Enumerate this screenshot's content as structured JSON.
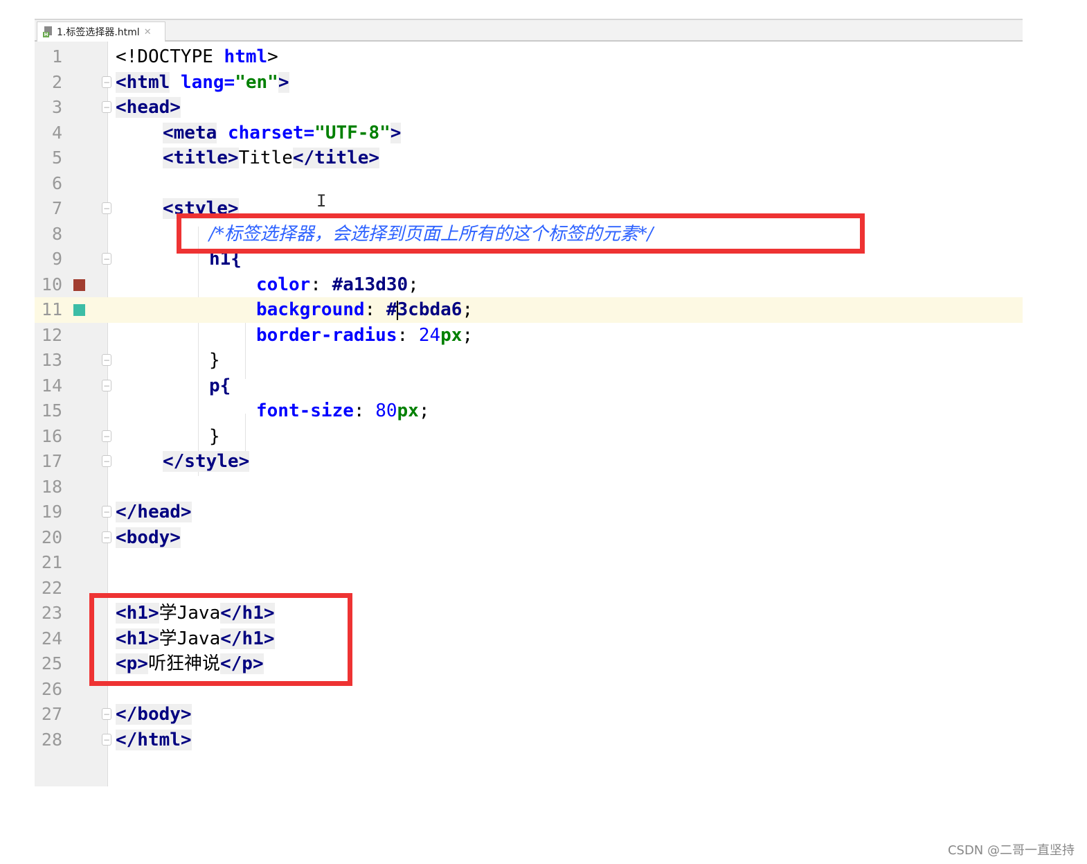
{
  "tab": {
    "filename": "1.标签选择器.html",
    "close_icon": "close-icon",
    "file_icon": "html-file-icon"
  },
  "editor": {
    "lines": [
      {
        "n": "1"
      },
      {
        "n": "2"
      },
      {
        "n": "3"
      },
      {
        "n": "4"
      },
      {
        "n": "5"
      },
      {
        "n": "6"
      },
      {
        "n": "7"
      },
      {
        "n": "8"
      },
      {
        "n": "9"
      },
      {
        "n": "10"
      },
      {
        "n": "11"
      },
      {
        "n": "12"
      },
      {
        "n": "13"
      },
      {
        "n": "14"
      },
      {
        "n": "15"
      },
      {
        "n": "16"
      },
      {
        "n": "17"
      },
      {
        "n": "18"
      },
      {
        "n": "19"
      },
      {
        "n": "20"
      },
      {
        "n": "21"
      },
      {
        "n": "22"
      },
      {
        "n": "23"
      },
      {
        "n": "24"
      },
      {
        "n": "25"
      },
      {
        "n": "26"
      },
      {
        "n": "27"
      },
      {
        "n": "28"
      }
    ],
    "code": {
      "l1_doctype": "<!DOCTYPE",
      "l1_html": "html",
      "l1_end": ">",
      "l2_tag": "<html",
      "l2_attr": "lang=",
      "l2_val": "\"en\"",
      "l2_end": ">",
      "l3": "<head>",
      "l4_tag": "<meta",
      "l4_attr": "charset=",
      "l4_val": "\"UTF-8\"",
      "l4_end": ">",
      "l5_open": "<title>",
      "l5_text": "Title",
      "l5_close": "</title>",
      "l7": "<style>",
      "l8_comment": "/*标签选择器，会选择到页面上所有的这个标签的元素*/",
      "l9": "h1{",
      "l10_prop": "color",
      "l10_colon": ": ",
      "l10_val": "#a13d30",
      "l10_semi": ";",
      "l11_prop": "background",
      "l11_colon": ": ",
      "l11_hash": "#",
      "l11_val": "3cbda6",
      "l11_semi": ";",
      "l12_prop": "border-radius",
      "l12_colon": ": ",
      "l12_num": "24",
      "l12_unit": "px",
      "l12_semi": ";",
      "l13": "}",
      "l14": "p{",
      "l15_prop": "font-size",
      "l15_colon": ": ",
      "l15_num": "80",
      "l15_unit": "px",
      "l15_semi": ";",
      "l16": "}",
      "l17": "</style>",
      "l19": "</head>",
      "l20": "<body>",
      "l23_open": "<h1>",
      "l23_text": "学Java",
      "l23_close": "</h1>",
      "l24_open": "<h1>",
      "l24_text": "学Java",
      "l24_close": "</h1>",
      "l25_open": "<p>",
      "l25_text": "听狂神说",
      "l25_close": "</p>",
      "l27": "</body>",
      "l28": "</html>"
    },
    "color_markers": {
      "line10": "#a13d30",
      "line11": "#3cbda6"
    },
    "highlight_color": "#fdf9e3",
    "annotation_color": "#ee3333"
  },
  "watermark": "CSDN @二哥一直坚持"
}
